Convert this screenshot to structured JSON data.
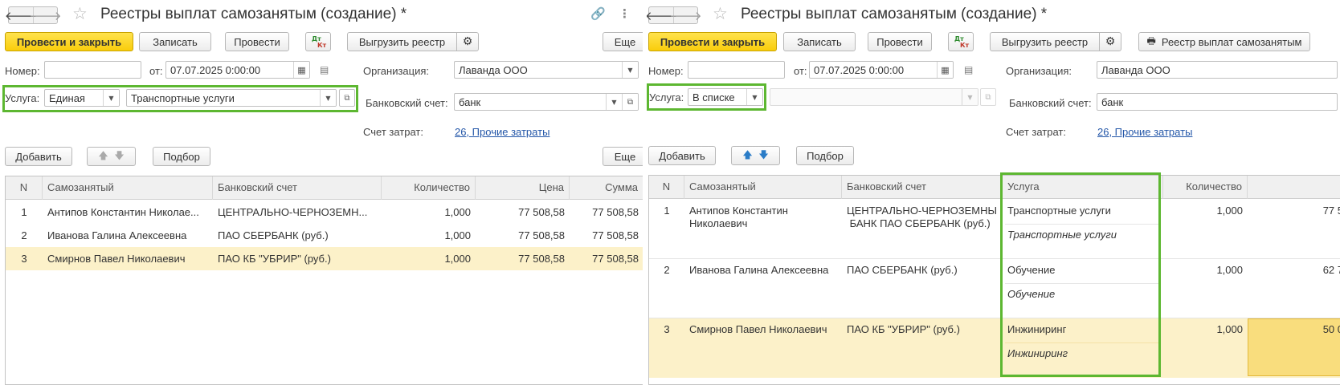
{
  "left": {
    "title": "Реестры выплат самозанятым (создание) *",
    "buttons": {
      "post_close": "Провести и закрыть",
      "save": "Записать",
      "post": "Провести",
      "dt": "Дт",
      "kt": "Кт",
      "export": "Выгрузить реестр",
      "more": "Еще"
    },
    "fields": {
      "number_label": "Номер:",
      "number_value": "",
      "date_label": "от:",
      "date_value": "07.07.2025  0:00:00",
      "org_label": "Организация:",
      "org_value": "Лаванда ООО",
      "service_label": "Услуга:",
      "service_mode": "Единая",
      "service_value": "Транспортные услуги",
      "bank_label": "Банковский счет:",
      "bank_value": "банк",
      "cost_label": "Счет затрат:",
      "cost_value": "26, Прочие затраты"
    },
    "table_toolbar": {
      "add": "Добавить",
      "pick": "Подбор",
      "more": "Еще"
    },
    "table": {
      "columns": [
        "N",
        "Самозанятый",
        "Банковский счет",
        "Количество",
        "Цена",
        "Сумма"
      ],
      "rows": [
        {
          "n": "1",
          "person": "Антипов Константин Николае...",
          "bank": "ЦЕНТРАЛЬНО-ЧЕРНОЗЕМН...",
          "qty": "1,000",
          "price": "77 508,58",
          "sum": "77 508,58"
        },
        {
          "n": "2",
          "person": "Иванова Галина Алексеевна",
          "bank": "ПАО СБЕРБАНК (руб.)",
          "qty": "1,000",
          "price": "77 508,58",
          "sum": "77 508,58"
        },
        {
          "n": "3",
          "person": "Смирнов Павел Николаевич",
          "bank": "ПАО КБ \"УБРИР\" (руб.)",
          "qty": "1,000",
          "price": "77 508,58",
          "sum": "77 508,58"
        }
      ]
    }
  },
  "right": {
    "title": "Реестры выплат самозанятым (создание) *",
    "buttons": {
      "post_close": "Провести и закрыть",
      "save": "Записать",
      "post": "Провести",
      "dt": "Дт",
      "kt": "Кт",
      "export": "Выгрузить реестр",
      "print_registry": "Реестр выплат самозанятым"
    },
    "fields": {
      "number_label": "Номер:",
      "number_value": "",
      "date_label": "от:",
      "date_value": "07.07.2025  0:00:00",
      "org_label": "Организация:",
      "org_value": "Лаванда ООО",
      "service_label": "Услуга:",
      "service_mode": "В списке",
      "service_value": "",
      "bank_label": "Банковский счет:",
      "bank_value": "банк",
      "cost_label": "Счет затрат:",
      "cost_value": "26, Прочие затраты"
    },
    "table_toolbar": {
      "add": "Добавить",
      "pick": "Подбор"
    },
    "table": {
      "columns": [
        "N",
        "Самозанятый",
        "Банковский счет",
        "Услуга",
        "Количество"
      ],
      "rows": [
        {
          "n": "1",
          "person_line1": "Антипов Константин",
          "person_line2": "Николаевич",
          "bank_line1": "ЦЕНТРАЛЬНО-ЧЕРНОЗЕМНЫ",
          "bank_line2": " БАНК ПАО СБЕРБАНК (руб.)",
          "service": "Транспортные услуги",
          "service_sub": "Транспортные услуги",
          "qty": "1,000",
          "amount_partial": "77 5"
        },
        {
          "n": "2",
          "person_line1": "Иванова Галина Алексеевна",
          "person_line2": "",
          "bank_line1": "ПАО СБЕРБАНК (руб.)",
          "bank_line2": "",
          "service": "Обучение",
          "service_sub": "Обучение",
          "qty": "1,000",
          "amount_partial": "62 7"
        },
        {
          "n": "3",
          "person_line1": "Смирнов Павел Николаевич",
          "person_line2": "",
          "bank_line1": "ПАО КБ \"УБРИР\" (руб.)",
          "bank_line2": "",
          "service": "Инжиниринг",
          "service_sub": "Инжиниринг",
          "qty": "1,000",
          "amount_partial": "50 0"
        }
      ]
    }
  },
  "colors": {
    "highlight_green": "#5db731",
    "primary_yellow": "#f9cd0b",
    "selected_row": "#fcf1c9",
    "link_blue": "#2356a8"
  },
  "icons": [
    "back-arrow-icon",
    "forward-arrow-icon",
    "star-icon",
    "link-icon",
    "more-vert-icon",
    "gear-icon",
    "calendar-icon",
    "report-icon",
    "open-form-icon",
    "dropdown-icon",
    "move-up-icon",
    "move-down-icon",
    "printer-icon"
  ]
}
